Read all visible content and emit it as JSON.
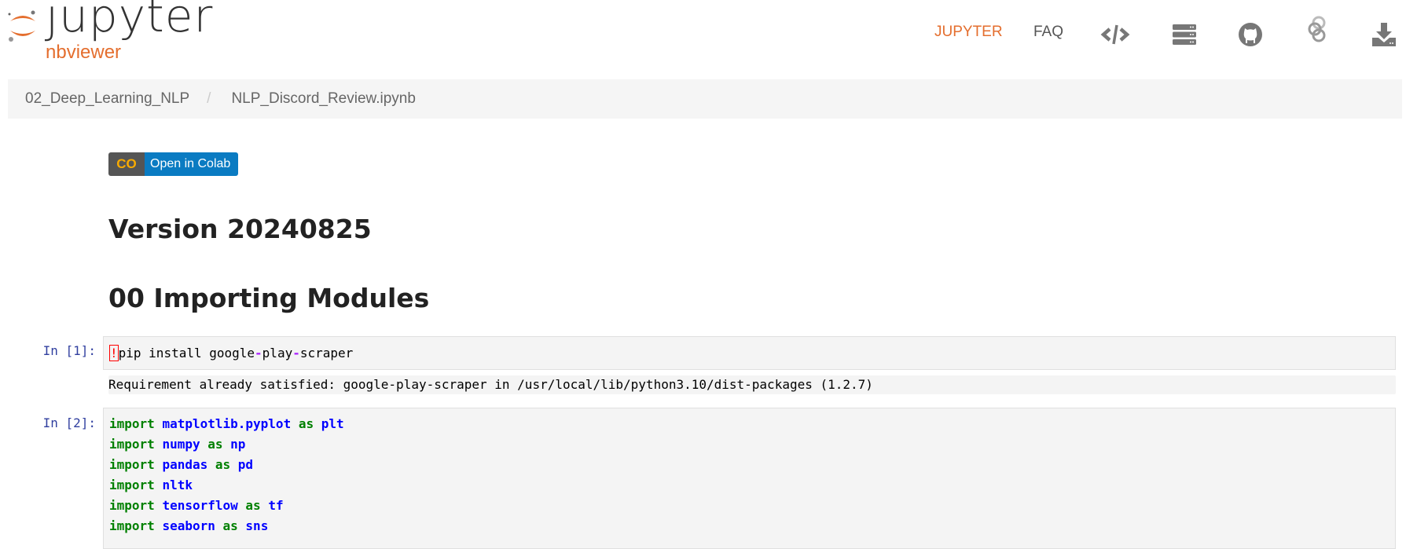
{
  "logo": {
    "word": "jupyter",
    "sub": "nbviewer"
  },
  "nav": {
    "jupyter": "JUPYTER",
    "faq": "FAQ",
    "icons": [
      "code-icon",
      "server-icon",
      "github-icon",
      "binder-icon",
      "download-icon"
    ]
  },
  "breadcrumb": {
    "parent": "02_Deep_Learning_NLP",
    "separator": "/",
    "current": "NLP_Discord_Review.ipynb"
  },
  "colab": {
    "logo": "CO",
    "label": "Open in Colab"
  },
  "headings": {
    "version": "Version 20240825",
    "section": "00 Importing Modules"
  },
  "cells": [
    {
      "prompt": "In [1]:",
      "bang": "!",
      "pip": "pip install google",
      "dash1": "-",
      "play": "play",
      "dash2": "-",
      "scraper": "scraper",
      "output": "Requirement already satisfied: google-play-scraper in /usr/local/lib/python3.10/dist-packages (1.2.7)"
    },
    {
      "prompt": "In [2]:",
      "lines": [
        {
          "kw": "import",
          "mod": "matplotlib.pyplot",
          "as": "as",
          "alias": "plt"
        },
        {
          "kw": "import",
          "mod": "numpy",
          "as": "as",
          "alias": "np"
        },
        {
          "kw": "import",
          "mod": "pandas",
          "as": "as",
          "alias": "pd"
        },
        {
          "kw": "import",
          "mod": "nltk"
        },
        {
          "kw": "import",
          "mod": "tensorflow",
          "as": "as",
          "alias": "tf"
        },
        {
          "kw": "import",
          "mod": "seaborn",
          "as": "as",
          "alias": "sns"
        }
      ]
    }
  ],
  "colors": {
    "accent": "#e46e2e",
    "prompt": "#303f9f",
    "keyword": "#008000",
    "name": "#0000ff"
  }
}
